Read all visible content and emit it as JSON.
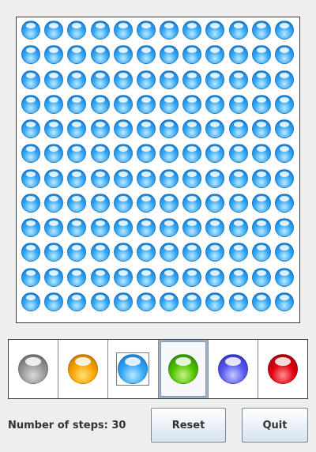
{
  "board": {
    "rows": 12,
    "cols": 12,
    "cell_color": "blue"
  },
  "colors": {
    "gray": {
      "light": "#d9d9d9",
      "mid": "#9a9a9a",
      "dark": "#5a5a5a"
    },
    "orange": {
      "light": "#ffe27a",
      "mid": "#f7a400",
      "dark": "#b86a00"
    },
    "blue": {
      "light": "#bfeaff",
      "mid": "#35a8f5",
      "dark": "#0a6fd1"
    },
    "green": {
      "light": "#c9f58a",
      "mid": "#4fc400",
      "dark": "#207a00"
    },
    "purple": {
      "light": "#c7c9ff",
      "mid": "#5a5cf0",
      "dark": "#2424b0"
    },
    "red": {
      "light": "#ff8f8f",
      "mid": "#e00010",
      "dark": "#8a0008"
    }
  },
  "palette": [
    {
      "color": "gray",
      "state": "normal"
    },
    {
      "color": "orange",
      "state": "normal"
    },
    {
      "color": "blue",
      "state": "hovered"
    },
    {
      "color": "green",
      "state": "selected"
    },
    {
      "color": "purple",
      "state": "normal"
    },
    {
      "color": "red",
      "state": "normal"
    }
  ],
  "status": {
    "steps_text": "Number of steps: 30",
    "steps": 30
  },
  "buttons": {
    "reset_label": "Reset",
    "quit_label": "Quit"
  }
}
